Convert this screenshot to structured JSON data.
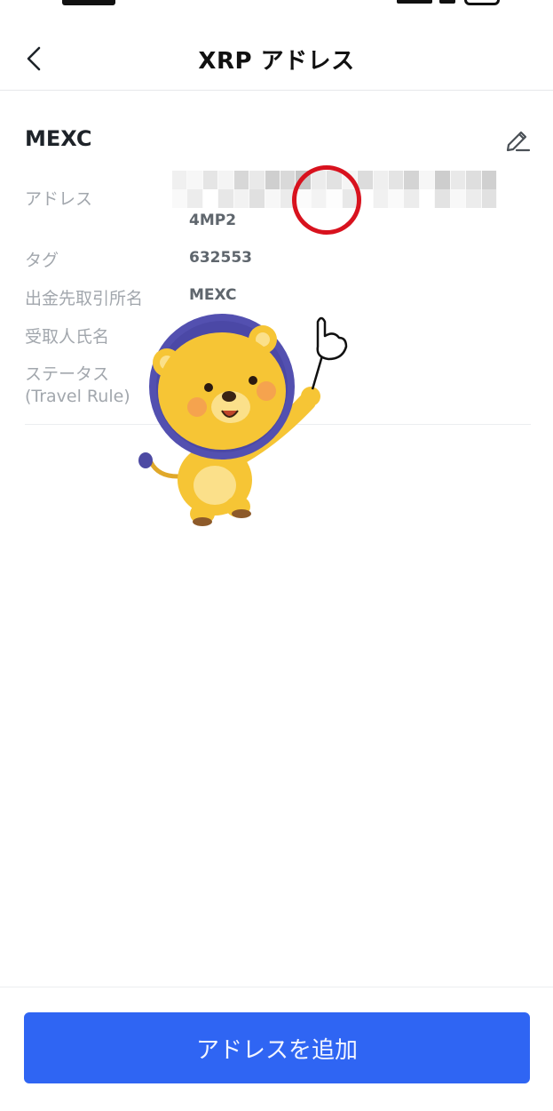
{
  "header": {
    "title": "XRP アドレス"
  },
  "entry": {
    "name": "MEXC",
    "rows": [
      {
        "label": "アドレス",
        "value": "4MP2"
      },
      {
        "label": "タグ",
        "value": "632553"
      },
      {
        "label": "出金先取引所名",
        "value": "MEXC"
      },
      {
        "label": "受取人氏名",
        "value": ""
      },
      {
        "label": "ステータス",
        "label2": "(Travel Rule)",
        "value": ""
      }
    ]
  },
  "footer": {
    "button_label": "アドレスを追加"
  },
  "colors": {
    "primary_button": "#2f65f3",
    "highlight_circle": "#d8121e",
    "label_gray": "#a2a7ad",
    "value_gray": "#5f666d"
  },
  "icons": {
    "back": "chevron-left-icon",
    "edit": "pencil-icon"
  }
}
